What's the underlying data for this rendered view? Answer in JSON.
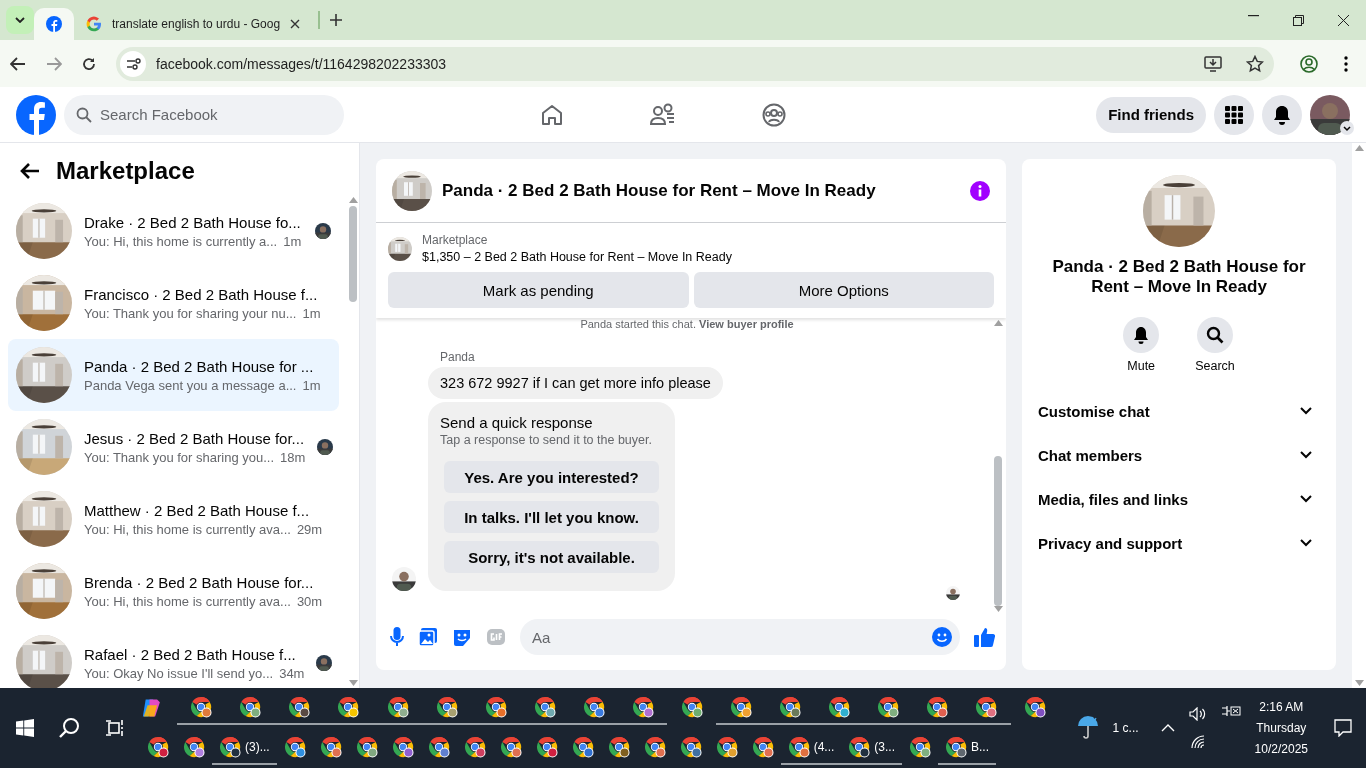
{
  "browser": {
    "tabs": [
      {
        "kind": "facebook",
        "selected": true
      },
      {
        "kind": "google",
        "title": "translate english to urdu - Goog",
        "selected": false
      }
    ],
    "address": "facebook.com/messages/t/1164298202233303"
  },
  "header": {
    "search_placeholder": "Search Facebook",
    "find_friends": "Find friends"
  },
  "sidebar": {
    "title": "Marketplace",
    "conversations": [
      {
        "name": "Drake · 2 Bed 2 Bath House fo...",
        "preview": "You: Hi, this home is currently a...",
        "time": "1m",
        "selected": false,
        "seen": true
      },
      {
        "name": "Francisco · 2 Bed 2 Bath House f...",
        "preview": "You: Thank you for sharing your nu...",
        "time": "1m",
        "selected": false,
        "seen": false
      },
      {
        "name": "Panda · 2 Bed 2 Bath House for ...",
        "preview": "Panda Vega sent you a message a...",
        "time": "1m",
        "selected": true,
        "seen": false
      },
      {
        "name": "Jesus · 2 Bed 2 Bath House for...",
        "preview": "You: Thank you for sharing you...",
        "time": "18m",
        "selected": false,
        "seen": true
      },
      {
        "name": "Matthew · 2 Bed 2 Bath House f...",
        "preview": "You: Hi, this home is currently ava...",
        "time": "29m",
        "selected": false,
        "seen": false
      },
      {
        "name": "Brenda · 2 Bed 2 Bath House for...",
        "preview": "You: Hi, this home is currently ava...",
        "time": "30m",
        "selected": false,
        "seen": false
      },
      {
        "name": "Rafael · 2 Bed 2 Bath House f...",
        "preview": "You: Okay No issue I'll send yo...",
        "time": "34m",
        "selected": false,
        "seen": true
      }
    ]
  },
  "chat": {
    "title": "Panda · 2 Bed 2 Bath House for Rent – Move In Ready",
    "listing_source": "Marketplace",
    "listing": "$1,350 – 2 Bed 2 Bath House for Rent – Move In Ready",
    "actions": [
      "Mark as pending",
      "More Options"
    ],
    "notice": "Panda started this chat. **View buyer profile**",
    "sender": "Panda",
    "message": "323 672 9927 if I can get more info please",
    "quick_response": {
      "title": "Send a quick response",
      "subtitle": "Tap a response to send it to the buyer.",
      "options": [
        "Yes. Are you interested?",
        "In talks. I'll let you know.",
        "Sorry, it's not available."
      ]
    },
    "composer_placeholder": "Aa"
  },
  "info": {
    "title": "Panda · 2 Bed 2 Bath House for Rent – Move In Ready",
    "actions": [
      {
        "kind": "mute",
        "label": "Mute"
      },
      {
        "kind": "search",
        "label": "Search"
      }
    ],
    "sections": [
      {
        "label": "Customise chat",
        "expanded": false
      },
      {
        "label": "Chat members",
        "expanded": false
      },
      {
        "label": "Media, files and links",
        "expanded": false
      },
      {
        "label": "Privacy and support",
        "expanded": false
      }
    ]
  },
  "taskbar": {
    "top_row": [
      {
        "color": "#e07a3a",
        "open": true
      },
      {
        "color": "#7fae7f",
        "open": true
      },
      {
        "color": "#5a4a44",
        "open": true
      },
      {
        "color": "#f5c400",
        "open": true
      },
      {
        "color": "#8fae8f",
        "open": true
      },
      {
        "color": "#a8a070",
        "open": true
      },
      {
        "color": "#e8702a",
        "open": true
      },
      {
        "color": "#70aab0",
        "open": true
      },
      {
        "color": "#3b7be0",
        "open": true
      },
      {
        "color": "#b070d0",
        "open": true
      },
      {
        "color": "#6fae6f",
        "open": false
      },
      {
        "color": "#f0a030",
        "open": true
      },
      {
        "color": "#6a7a5a",
        "open": true
      },
      {
        "color": "#30b0d0",
        "open": true
      },
      {
        "color": "#7fae7f",
        "open": true
      },
      {
        "color": "#e06050",
        "open": true
      },
      {
        "color": "#e07080",
        "open": true
      },
      {
        "color": "#8050c0",
        "open": false
      }
    ],
    "bottom_row": [
      {
        "color": "#d02040",
        "open": false
      },
      {
        "color": "#b080e0",
        "open": false
      },
      {
        "color": "#203040",
        "label": "(3)...",
        "open": true
      },
      {
        "color": "#3090e0",
        "open": false
      },
      {
        "color": "#e07050",
        "open": false
      },
      {
        "color": "#80a880",
        "open": false
      },
      {
        "color": "#9060d0",
        "open": false
      },
      {
        "color": "#6080d0",
        "open": false
      },
      {
        "color": "#d04060",
        "open": false
      },
      {
        "color": "#e07050",
        "open": false
      },
      {
        "color": "#d02040",
        "open": false
      },
      {
        "color": "#3070d0",
        "open": false
      },
      {
        "color": "#806020",
        "open": false
      },
      {
        "color": "#e07050",
        "open": false
      },
      {
        "color": "#4070a0",
        "open": false
      },
      {
        "color": "#e0a030",
        "open": false
      },
      {
        "color": "#e07050",
        "open": false
      },
      {
        "color": "#e07040",
        "label": "(4...",
        "open": true
      },
      {
        "color": "#203040",
        "label": "(3...",
        "open": true
      },
      {
        "color": "#80b080",
        "open": false
      },
      {
        "color": "#606870",
        "label": "B...",
        "open": true
      }
    ],
    "weather": "1 c...",
    "time": "2:16 AM",
    "day": "Thursday",
    "date": "10/2/2025"
  }
}
